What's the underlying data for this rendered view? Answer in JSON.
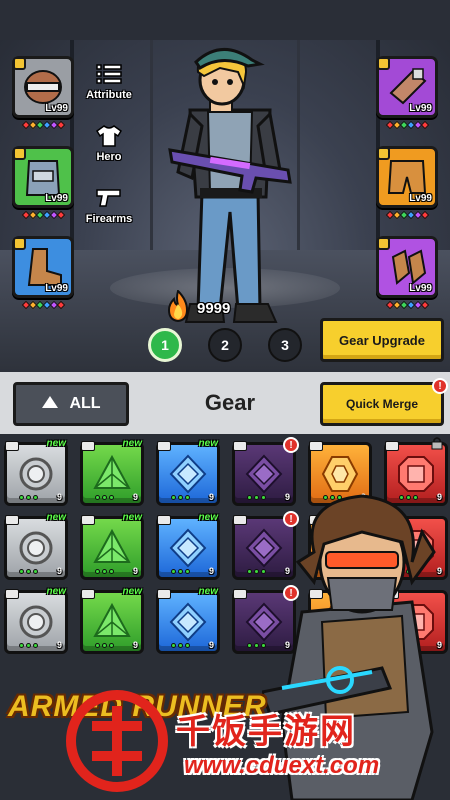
{
  "equipment": {
    "left_slots": [
      {
        "name": "helmet",
        "level": "Lv99",
        "color": "#9a9ea4"
      },
      {
        "name": "vest",
        "level": "Lv99",
        "color": "#4fc14a"
      },
      {
        "name": "boots",
        "level": "Lv99",
        "color": "#3d8ee0"
      }
    ],
    "right_slots": [
      {
        "name": "armguard",
        "level": "Lv99",
        "color": "#a34ad6"
      },
      {
        "name": "shorts",
        "level": "Lv99",
        "color": "#f09b20"
      },
      {
        "name": "gloves",
        "level": "Lv99",
        "color": "#b052e2"
      }
    ],
    "lock_icon": "lock-badge-icon"
  },
  "side_menu": {
    "attribute": "Attribute",
    "hero": "Hero",
    "firearms": "Firearms"
  },
  "power": {
    "value": "9999",
    "icon": "flame-icon"
  },
  "pages": [
    "1",
    "2",
    "3"
  ],
  "active_page": "1",
  "gear_upgrade_label": "Gear Upgrade",
  "inventory": {
    "filter_label": "ALL",
    "title": "Gear",
    "quick_merge_label": "Quick Merge",
    "alert_glyph": "!",
    "rows": [
      [
        {
          "type": "silver",
          "icon": "ring-icon",
          "count": "9",
          "new": "new"
        },
        {
          "type": "green",
          "icon": "triangle-gem-icon",
          "count": "9",
          "new": "new"
        },
        {
          "type": "blue",
          "icon": "diamond-gem-icon",
          "count": "9",
          "new": "new"
        },
        {
          "type": "purple",
          "icon": "diamond-gem-icon",
          "count": "9",
          "new": "",
          "alert": true
        },
        {
          "type": "orange",
          "icon": "hexagon-gem-icon",
          "count": "9",
          "new": ""
        },
        {
          "type": "red",
          "icon": "octagon-gem-icon",
          "count": "9",
          "new": "",
          "lock": true
        }
      ],
      [
        {
          "type": "silver",
          "icon": "ring-icon",
          "count": "9",
          "new": "new"
        },
        {
          "type": "green",
          "icon": "triangle-gem-icon",
          "count": "9",
          "new": "new"
        },
        {
          "type": "blue",
          "icon": "diamond-gem-icon",
          "count": "9",
          "new": "new"
        },
        {
          "type": "purple",
          "icon": "diamond-gem-icon",
          "count": "9",
          "new": "",
          "alert": true
        },
        {
          "type": "orange",
          "icon": "hexagon-gem-icon",
          "count": "9",
          "new": ""
        },
        {
          "type": "red",
          "icon": "octagon-gem-icon",
          "count": "9",
          "new": ""
        }
      ],
      [
        {
          "type": "silver",
          "icon": "ring-icon",
          "count": "9",
          "new": "new"
        },
        {
          "type": "green",
          "icon": "triangle-gem-icon",
          "count": "9",
          "new": "new"
        },
        {
          "type": "blue",
          "icon": "diamond-gem-icon",
          "count": "9",
          "new": "new"
        },
        {
          "type": "purple",
          "icon": "diamond-gem-icon",
          "count": "9",
          "new": "",
          "alert": true
        },
        {
          "type": "orange",
          "icon": "hexagon-gem-icon",
          "count": "9",
          "new": ""
        },
        {
          "type": "red",
          "icon": "octagon-gem-icon",
          "count": "9",
          "new": ""
        }
      ]
    ]
  },
  "promo": {
    "logo_text": "ARMED RUNNER",
    "watermark_cn": "千饭手游网",
    "watermark_url": "www.cduext.com"
  }
}
